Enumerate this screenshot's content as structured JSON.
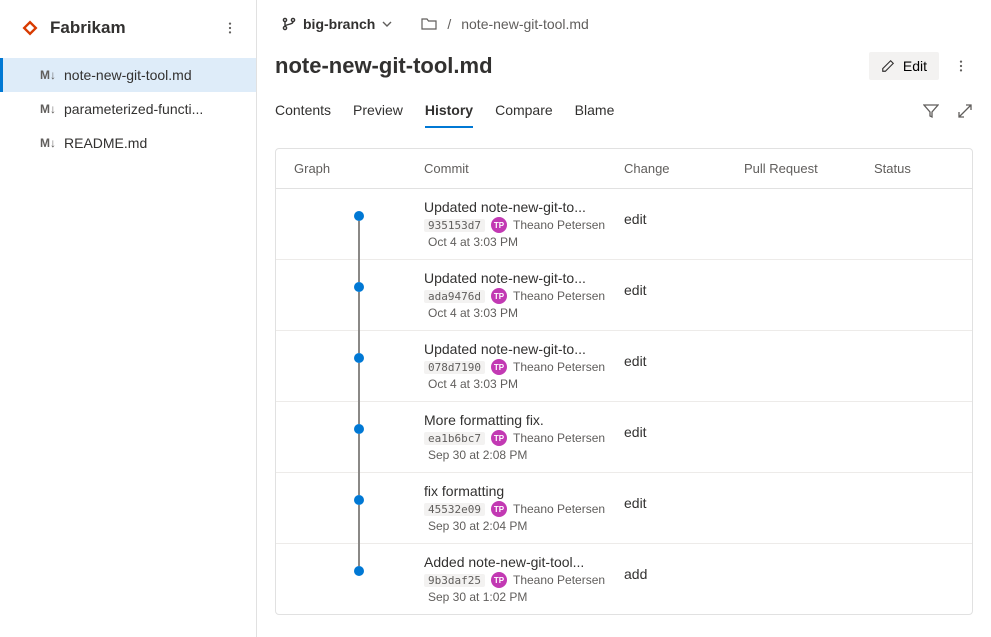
{
  "brand": {
    "name": "Fabrikam"
  },
  "files": [
    {
      "icon": "M↓",
      "name": "note-new-git-tool.md",
      "selected": true
    },
    {
      "icon": "M↓",
      "name": "parameterized-functi...",
      "selected": false
    },
    {
      "icon": "M↓",
      "name": "README.md",
      "selected": false
    }
  ],
  "branch": {
    "name": "big-branch"
  },
  "breadcrumb": {
    "file": "note-new-git-tool.md"
  },
  "page": {
    "title": "note-new-git-tool.md"
  },
  "actions": {
    "edit": "Edit"
  },
  "tabs": [
    {
      "label": "Contents",
      "active": false
    },
    {
      "label": "Preview",
      "active": false
    },
    {
      "label": "History",
      "active": true
    },
    {
      "label": "Compare",
      "active": false
    },
    {
      "label": "Blame",
      "active": false
    }
  ],
  "columns": {
    "graph": "Graph",
    "commit": "Commit",
    "change": "Change",
    "pullRequest": "Pull Request",
    "status": "Status"
  },
  "commits": [
    {
      "message": "Updated note-new-git-to...",
      "hash": "935153d7",
      "author": "Theano Petersen",
      "initials": "TP",
      "time": "Oct 4 at 3:03 PM",
      "change": "edit",
      "first": true,
      "last": false
    },
    {
      "message": "Updated note-new-git-to...",
      "hash": "ada9476d",
      "author": "Theano Petersen",
      "initials": "TP",
      "time": "Oct 4 at 3:03 PM",
      "change": "edit",
      "first": false,
      "last": false
    },
    {
      "message": "Updated note-new-git-to...",
      "hash": "078d7190",
      "author": "Theano Petersen",
      "initials": "TP",
      "time": "Oct 4 at 3:03 PM",
      "change": "edit",
      "first": false,
      "last": false
    },
    {
      "message": "More formatting fix.",
      "hash": "ea1b6bc7",
      "author": "Theano Petersen",
      "initials": "TP",
      "time": "Sep 30 at 2:08 PM",
      "change": "edit",
      "first": false,
      "last": false
    },
    {
      "message": "fix formatting",
      "hash": "45532e09",
      "author": "Theano Petersen",
      "initials": "TP",
      "time": "Sep 30 at 2:04 PM",
      "change": "edit",
      "first": false,
      "last": false
    },
    {
      "message": "Added note-new-git-tool...",
      "hash": "9b3daf25",
      "author": "Theano Petersen",
      "initials": "TP",
      "time": "Sep 30 at 1:02 PM",
      "change": "add",
      "first": false,
      "last": true
    }
  ]
}
